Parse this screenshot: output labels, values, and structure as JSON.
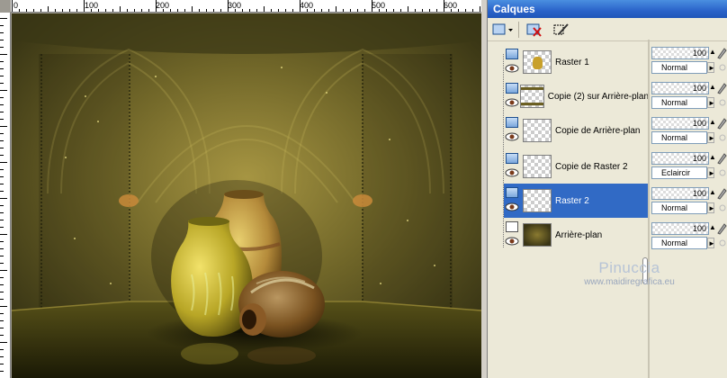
{
  "ruler": {
    "labels": [
      "0",
      "100",
      "200",
      "300",
      "400",
      "500",
      "600"
    ]
  },
  "palette": {
    "title": "Calques"
  },
  "toolbar": {
    "new_layer_icon": "new-raster-layer-icon",
    "delete_icon": "delete-layer-icon",
    "edit_icon": "edit-selection-icon"
  },
  "layers": [
    {
      "name": "Raster 1",
      "opacity": "100",
      "blend": "Normal",
      "thumb": "vase"
    },
    {
      "name": "Copie (2) sur Arrière-plan",
      "opacity": "100",
      "blend": "Normal",
      "thumb": "bands"
    },
    {
      "name": "Copie de Arrière-plan",
      "opacity": "100",
      "blend": "Normal",
      "thumb": "transparent"
    },
    {
      "name": "Copie de Raster 2",
      "opacity": "100",
      "blend": "Eclaircir",
      "thumb": "transparent"
    },
    {
      "name": "Raster 2",
      "opacity": "100",
      "blend": "Normal",
      "thumb": "transparent",
      "selected": true
    },
    {
      "name": "Arrière-plan",
      "opacity": "100",
      "blend": "Normal",
      "thumb": "background"
    }
  ],
  "watermark": {
    "title": "Pinuccia",
    "url": "www.maidiregrafica.eu"
  },
  "colors": {
    "selection": "#316ac5",
    "titlebar": "#2a63c9"
  }
}
